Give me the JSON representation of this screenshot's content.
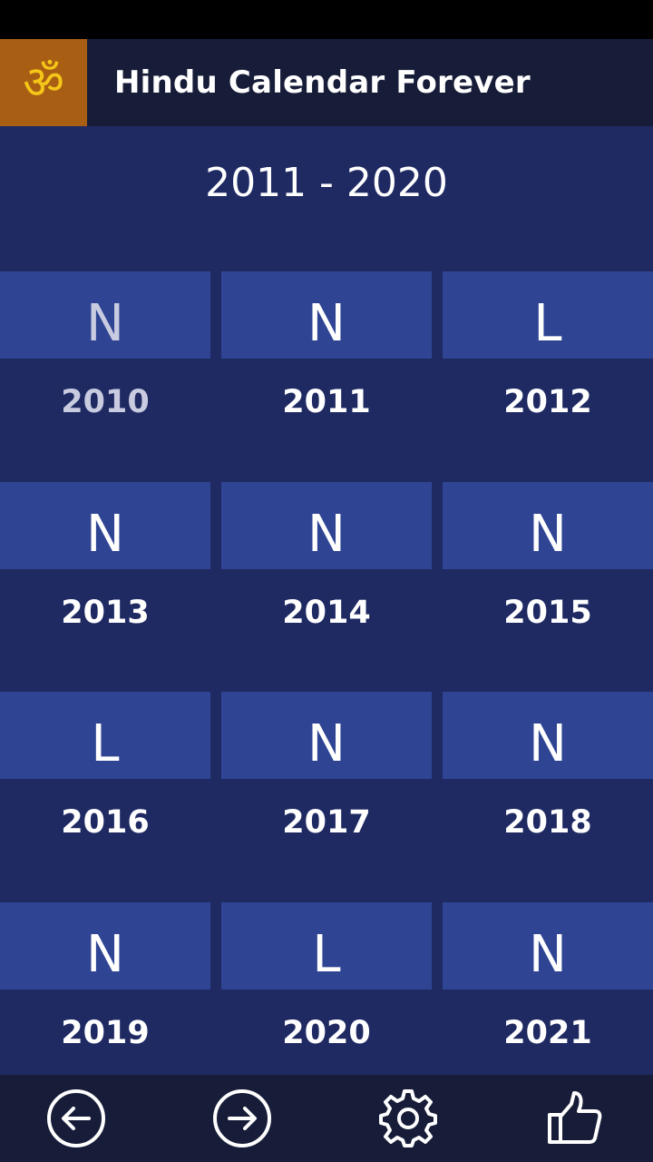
{
  "app": {
    "title": "Hindu Calendar Forever",
    "logo_symbol": "ॐ"
  },
  "decade": {
    "range_label": "2011 - 2020"
  },
  "years": [
    {
      "letter": "N",
      "year": "2010",
      "dim": true
    },
    {
      "letter": "N",
      "year": "2011",
      "dim": false
    },
    {
      "letter": "L",
      "year": "2012",
      "dim": false
    },
    {
      "letter": "N",
      "year": "2013",
      "dim": false
    },
    {
      "letter": "N",
      "year": "2014",
      "dim": false
    },
    {
      "letter": "N",
      "year": "2015",
      "dim": false
    },
    {
      "letter": "L",
      "year": "2016",
      "dim": false
    },
    {
      "letter": "N",
      "year": "2017",
      "dim": false
    },
    {
      "letter": "N",
      "year": "2018",
      "dim": false
    },
    {
      "letter": "N",
      "year": "2019",
      "dim": false
    },
    {
      "letter": "L",
      "year": "2020",
      "dim": false
    },
    {
      "letter": "N",
      "year": "2021",
      "dim": false
    }
  ],
  "toolbar": {
    "buttons": [
      {
        "name": "previous-button",
        "icon": "arrow-left-circle-icon"
      },
      {
        "name": "next-button",
        "icon": "arrow-right-circle-icon"
      },
      {
        "name": "settings-button",
        "icon": "gear-icon"
      },
      {
        "name": "like-button",
        "icon": "thumbs-up-icon"
      }
    ]
  },
  "colors": {
    "background": "#1f2a63",
    "tile": "#2f4594",
    "header": "#171d38",
    "logo_bg": "#a85f14",
    "logo_symbol": "#f5c518"
  }
}
